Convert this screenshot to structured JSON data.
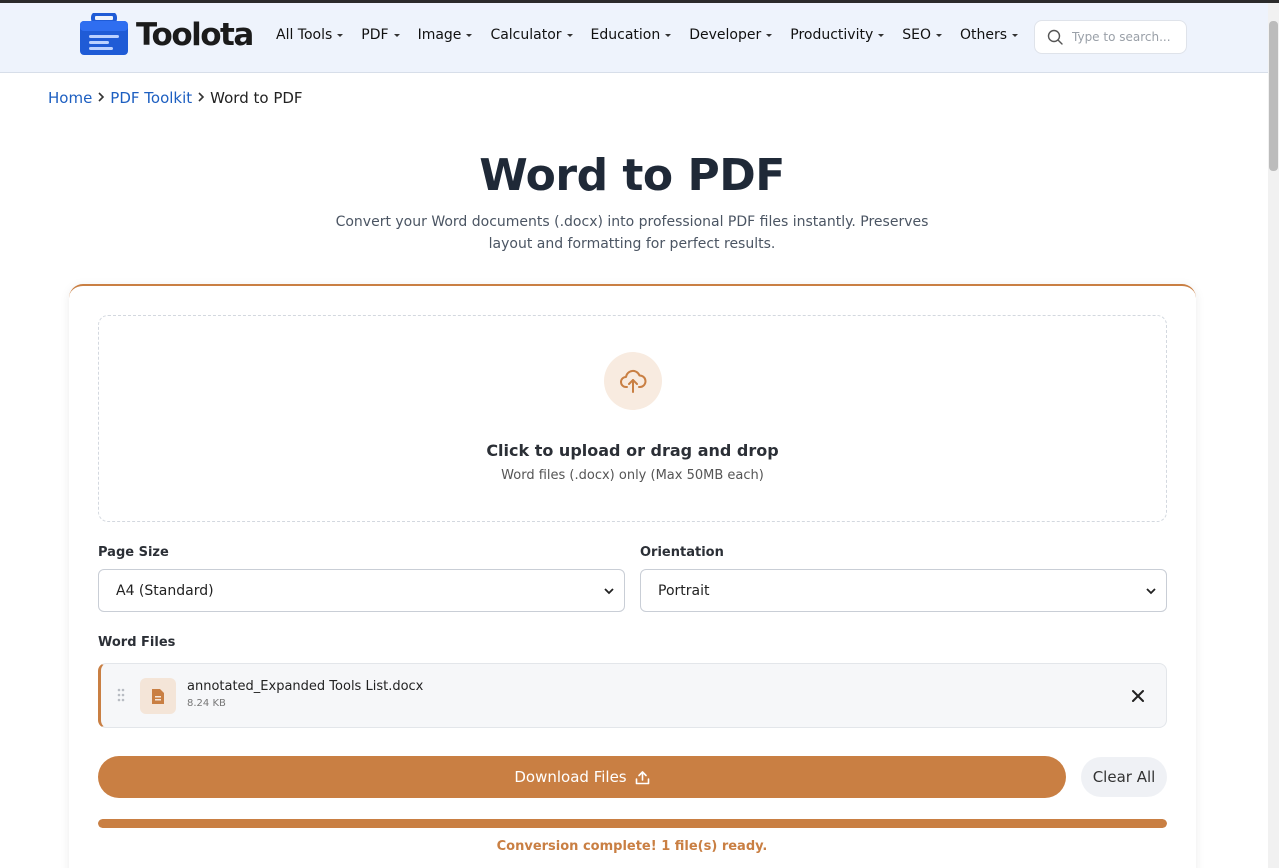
{
  "header": {
    "brand": "Toolota",
    "nav": [
      {
        "label": "All Tools"
      },
      {
        "label": "PDF"
      },
      {
        "label": "Image"
      },
      {
        "label": "Calculator"
      },
      {
        "label": "Education"
      },
      {
        "label": "Developer"
      },
      {
        "label": "Productivity"
      },
      {
        "label": "SEO"
      },
      {
        "label": "Others"
      }
    ],
    "search_placeholder": "Type to search..."
  },
  "breadcrumb": {
    "home": "Home",
    "section": "PDF Toolkit",
    "current": "Word to PDF"
  },
  "page": {
    "title": "Word to PDF",
    "subtitle": "Convert your Word documents (.docx) into professional PDF files instantly. Preserves layout and formatting for perfect results."
  },
  "dropzone": {
    "title": "Click to upload or drag and drop",
    "hint": "Word files (.docx) only (Max 50MB each)"
  },
  "options": {
    "page_size_label": "Page Size",
    "page_size_value": "A4 (Standard)",
    "orientation_label": "Orientation",
    "orientation_value": "Portrait"
  },
  "files": {
    "label": "Word Files",
    "items": [
      {
        "name": "annotated_Expanded Tools List.docx",
        "size": "8.24 KB"
      }
    ]
  },
  "actions": {
    "download_label": "Download Files",
    "clear_label": "Clear All"
  },
  "progress": {
    "percent": 100,
    "status": "Conversion complete! 1 file(s) ready."
  },
  "colors": {
    "accent": "#c97f43",
    "link": "#1d5fc1",
    "navbar_bg": "#eef3fc",
    "logo_blue": "#1f5bd6"
  }
}
